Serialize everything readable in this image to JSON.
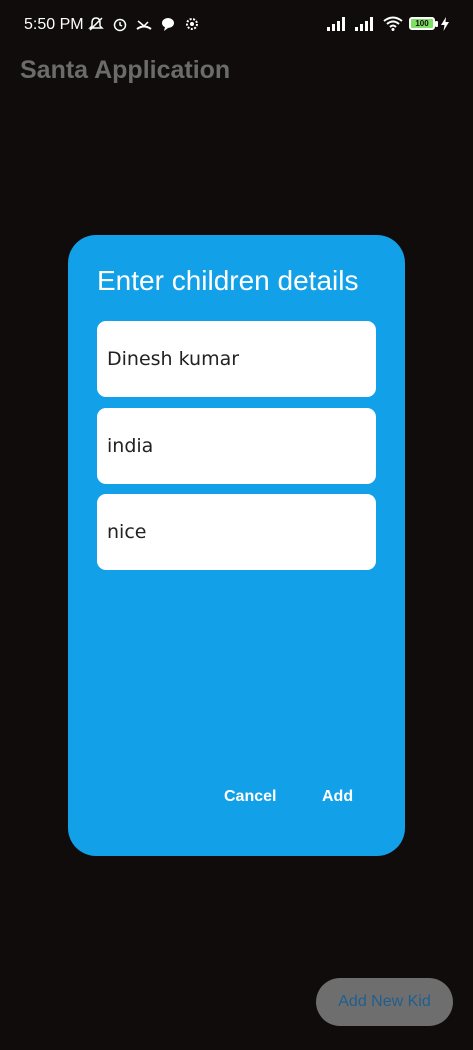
{
  "status_bar": {
    "time": "5:50 PM",
    "battery": "100"
  },
  "app_bar": {
    "title": "Santa Application"
  },
  "dialog": {
    "title": "Enter children details",
    "fields": [
      {
        "value": "Dinesh kumar"
      },
      {
        "value": "india"
      },
      {
        "value": "nice"
      }
    ],
    "cancel_label": "Cancel",
    "add_label": "Add"
  },
  "fab": {
    "label": "Add New Kid"
  },
  "colors": {
    "background": "#0f0c0b",
    "dialog": "#12a0e8",
    "fab": "#6e6e6e",
    "fab_text": "#1f5f8f",
    "battery": "#7ddf64"
  }
}
